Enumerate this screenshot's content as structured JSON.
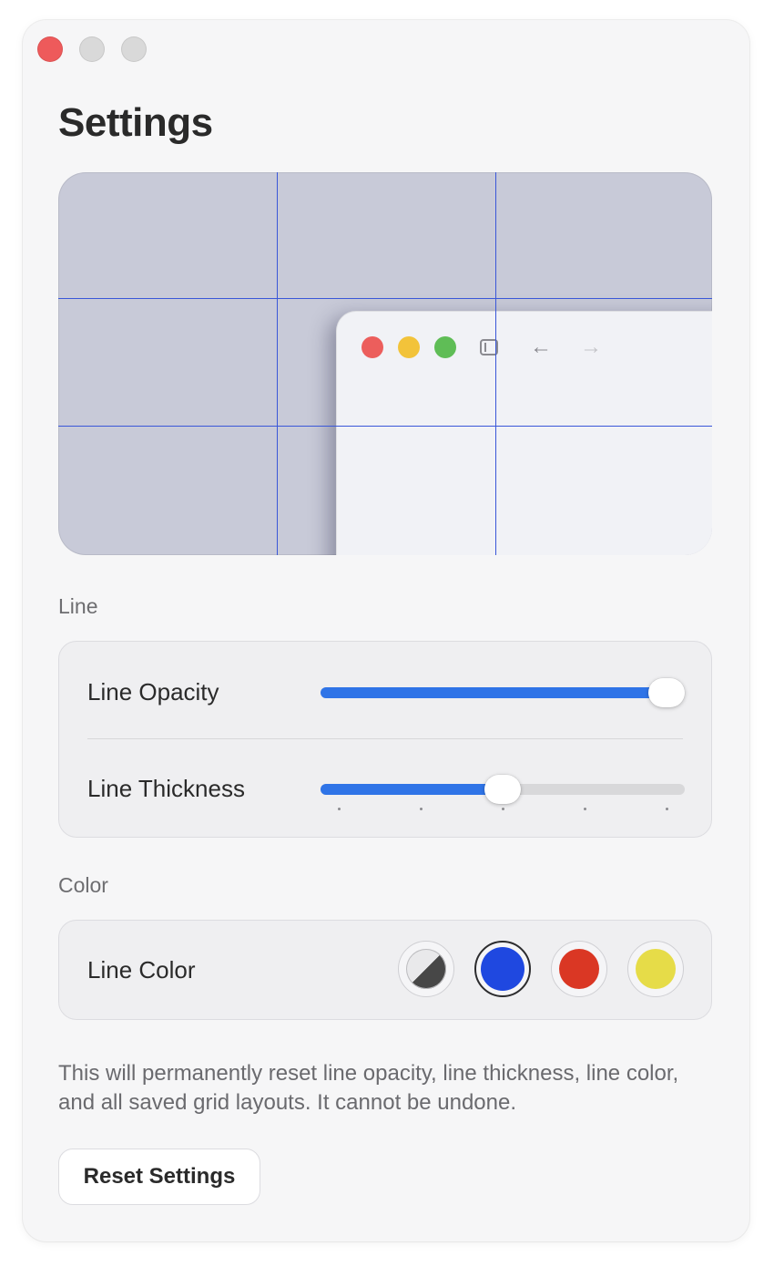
{
  "window": {
    "title": "Settings"
  },
  "preview": {
    "grid_color": "#3a57d8",
    "background": "#c8cad8"
  },
  "line_section": {
    "label": "Line",
    "opacity_label": "Line Opacity",
    "opacity_value": 0.95,
    "thickness_label": "Line Thickness",
    "thickness_value": 0.5
  },
  "color_section": {
    "label": "Color",
    "color_label": "Line Color",
    "swatches": [
      {
        "name": "auto",
        "color": "#474747",
        "selected": false
      },
      {
        "name": "blue",
        "color": "#1f48e0",
        "selected": true
      },
      {
        "name": "red",
        "color": "#da3724",
        "selected": false
      },
      {
        "name": "yellow",
        "color": "#e6dc48",
        "selected": false
      }
    ]
  },
  "reset": {
    "note": "This will permanently reset line opacity, line thickness, line color, and all saved grid layouts. It cannot be undone.",
    "button_label": "Reset Settings"
  },
  "accent_color": "#2f74e7"
}
